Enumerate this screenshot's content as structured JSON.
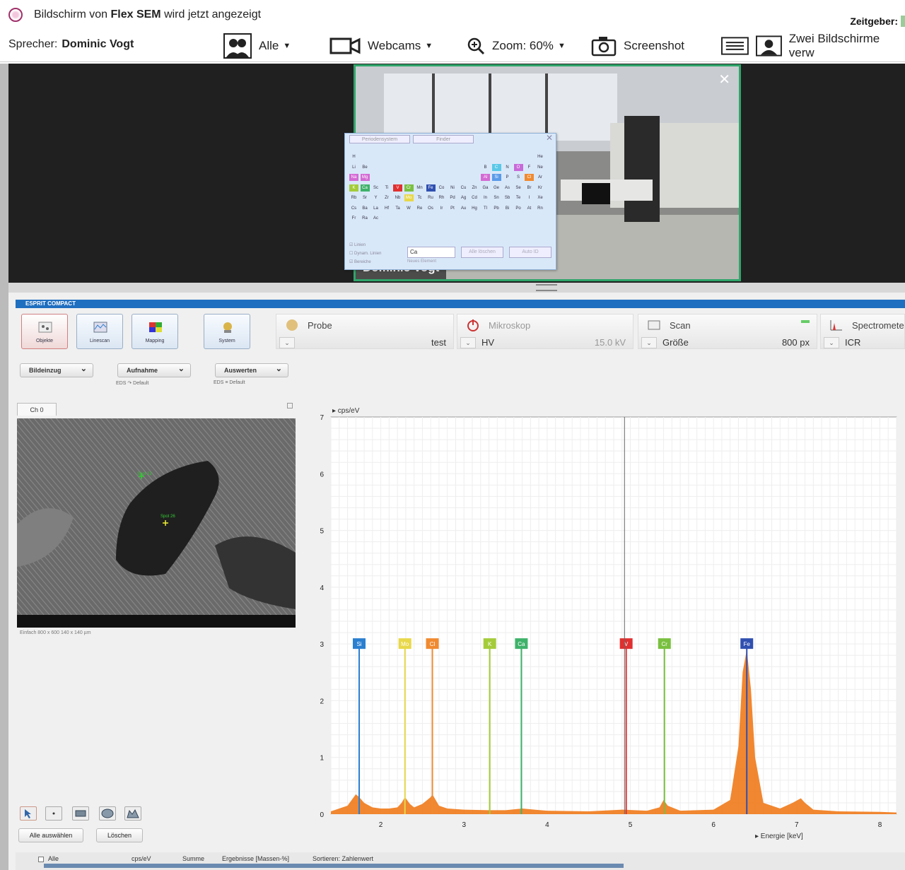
{
  "titlebar": {
    "title_prefix": "Bildschirm von ",
    "title_app": "Flex SEM",
    "title_suffix": " wird jetzt angezeigt",
    "timer_label": "Zeitgeber:"
  },
  "toolbar": {
    "speaker_label": "Sprecher:",
    "speaker_name": "Dominic Vogt",
    "all_label": "Alle",
    "webcams_label": "Webcams",
    "zoom_label": "Zoom: 60%",
    "screenshot_label": "Screenshot",
    "dual_label": "Zwei Bildschirme verw"
  },
  "video": {
    "participant_name": "Dominic Vogt",
    "border_color": "#2fa56a"
  },
  "esprit": {
    "header": "ESPRIT COMPACT",
    "buttons": [
      "Objekte",
      "Linescan",
      "Mapping",
      "System"
    ],
    "probe": {
      "label": "Probe",
      "value": "test"
    },
    "microscope": {
      "label": "Mikroskop",
      "hv_label": "HV",
      "hv_value": "15.0 kV"
    },
    "scan": {
      "label": "Scan",
      "size_label": "Größe",
      "size_value": "800 px"
    },
    "spectrometer": {
      "label": "Spectromete",
      "value_label": "ICR"
    },
    "combos": [
      "Bildeinzug",
      "Aufnahme",
      "Auswerten"
    ],
    "combo_subs": [
      "EDS  ↷ Default",
      "EDS  ≡ Default"
    ],
    "image_tab": "Ch 0",
    "image_caption": "Einfach     800 x 600   140 x 140 µm",
    "select_all": "Alle auswählen",
    "delete": "Löschen",
    "bottombar": [
      "Alle",
      "cps/eV",
      "Summe",
      "Ergebnisse [Massen-%]",
      "Sortieren: Zahlenwert"
    ]
  },
  "periodic_popup": {
    "tabs": [
      "Periodensystem",
      "Finder"
    ],
    "checks": [
      "Linien",
      "Dynam. Linien",
      "Bereiche"
    ],
    "element_input": "Ca",
    "clear_all": "Alle löschen",
    "auto_id": "Auto ID",
    "new_element": "Neues Element"
  },
  "chart_data": {
    "type": "area",
    "ylabel": "cps/eV",
    "xlabel": "Energie [keV]",
    "xlim": [
      1.4,
      8.2
    ],
    "ylim": [
      0,
      7
    ],
    "x_ticks": [
      2,
      3,
      4,
      5,
      6,
      7,
      8
    ],
    "y_ticks": [
      0,
      1,
      2,
      3,
      4,
      5,
      6,
      7
    ],
    "grid": true,
    "cursor_x": 4.93,
    "series": [
      {
        "color": "#f07a1a",
        "x": [
          1.4,
          1.5,
          1.6,
          1.65,
          1.7,
          1.74,
          1.8,
          1.9,
          2.0,
          2.1,
          2.2,
          2.25,
          2.29,
          2.35,
          2.4,
          2.5,
          2.6,
          2.62,
          2.7,
          2.8,
          3.0,
          3.3,
          3.5,
          3.7,
          4.0,
          4.5,
          4.9,
          5.2,
          5.35,
          5.4,
          5.45,
          5.6,
          6.0,
          6.2,
          6.3,
          6.35,
          6.4,
          6.45,
          6.5,
          6.6,
          6.8,
          6.95,
          7.05,
          7.1,
          7.2,
          7.5,
          8.0,
          8.2
        ],
        "y": [
          0.05,
          0.1,
          0.15,
          0.25,
          0.35,
          0.3,
          0.2,
          0.12,
          0.1,
          0.1,
          0.12,
          0.2,
          0.3,
          0.18,
          0.12,
          0.18,
          0.3,
          0.35,
          0.15,
          0.1,
          0.08,
          0.07,
          0.07,
          0.1,
          0.06,
          0.05,
          0.08,
          0.06,
          0.12,
          0.25,
          0.15,
          0.06,
          0.08,
          0.25,
          1.2,
          2.5,
          2.9,
          2.2,
          1.0,
          0.2,
          0.1,
          0.2,
          0.28,
          0.2,
          0.08,
          0.05,
          0.04,
          0.03
        ]
      }
    ],
    "markers": [
      {
        "label": "Si",
        "x": 1.74,
        "color": "#2a7fd0",
        "h": 0.55
      },
      {
        "label": "Mo",
        "x": 2.29,
        "color": "#e8d84a",
        "h": 0.35
      },
      {
        "label": "Cl",
        "x": 2.62,
        "color": "#f08a30",
        "h": 0.55
      },
      {
        "label": "K",
        "x": 3.31,
        "color": "#a4cc3a",
        "h": 0.4
      },
      {
        "label": "Ca",
        "x": 3.69,
        "color": "#3fb26a",
        "h": 0.4
      },
      {
        "label": "V",
        "x": 4.95,
        "color": "#e03030",
        "h": 1.4
      },
      {
        "label": "Cr",
        "x": 5.41,
        "color": "#7ac040",
        "h": 0.6
      },
      {
        "label": "Fe",
        "x": 6.4,
        "color": "#3050b0",
        "h": 1.4
      }
    ]
  }
}
